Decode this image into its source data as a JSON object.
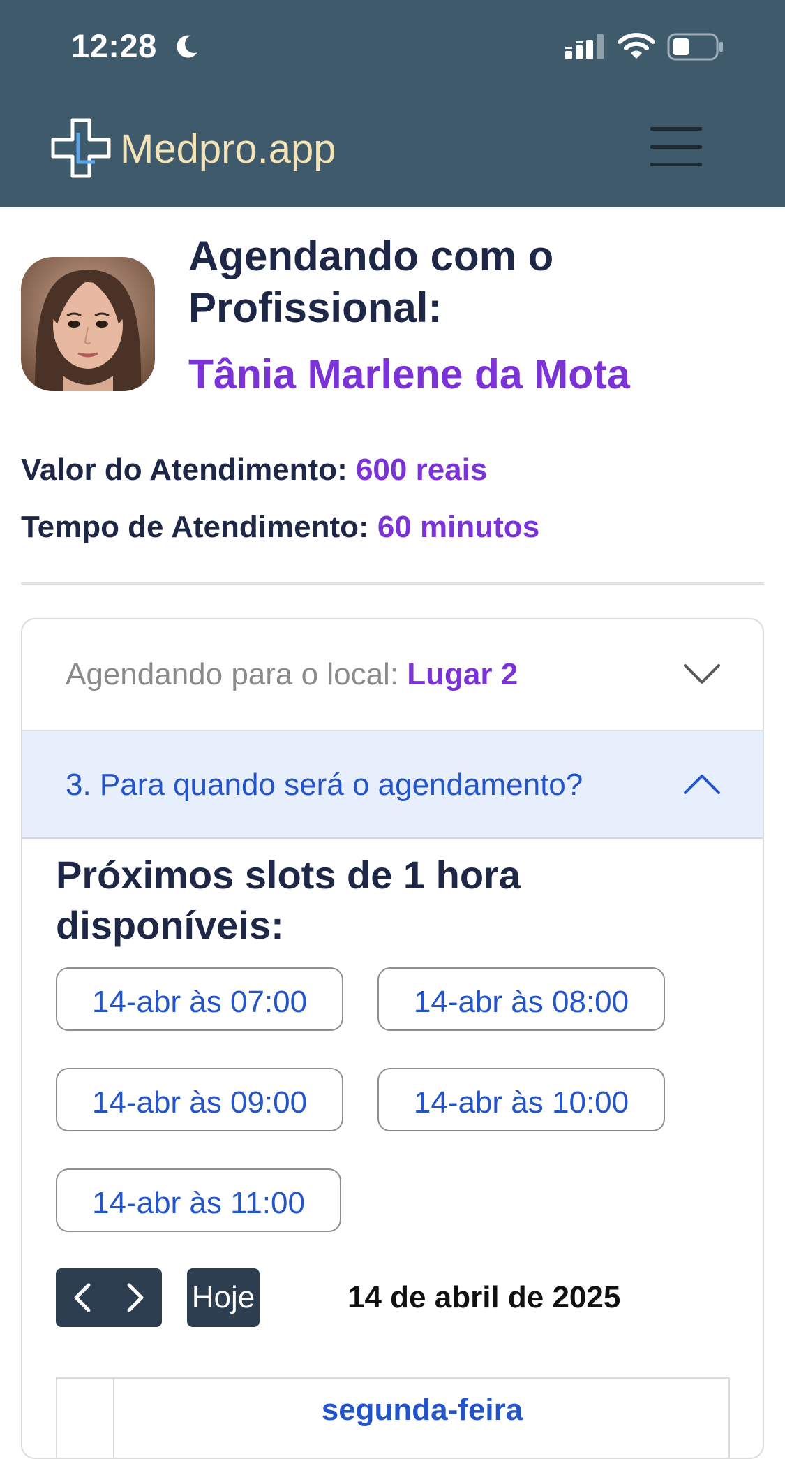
{
  "status_bar": {
    "time": "12:28"
  },
  "brand": {
    "name": "Medpro.app"
  },
  "profile": {
    "heading": "Agendando com o Profissional:",
    "name": "Tânia Marlene da Mota"
  },
  "details": {
    "price_label": "Valor do Atendimento:",
    "price_value": "600 reais",
    "duration_label": "Tempo de Atendimento:",
    "duration_value": "60 minutos"
  },
  "accordion": {
    "location_label": "Agendando para o local:",
    "location_value": "Lugar 2",
    "when_label": "3. Para quando será o agendamento?"
  },
  "slots": {
    "title": "Próximos slots de 1 hora disponíveis:",
    "items": [
      "14-abr às 07:00",
      "14-abr às 08:00",
      "14-abr às 09:00",
      "14-abr às 10:00",
      "14-abr às 11:00"
    ]
  },
  "calendar": {
    "today_label": "Hoje",
    "current_date": "14 de abril de 2025",
    "day_header": "segunda-feira"
  },
  "colors": {
    "topbar": "#3f5a6b",
    "brand_text": "#f3e3b6",
    "accent_purple": "#7b33d8",
    "link_blue": "#2355c9",
    "heading_navy": "#1e2846",
    "button_dark": "#2c3e50"
  },
  "icons": {
    "moon": "moon-icon",
    "signal": "cellular-signal-icon",
    "wifi": "wifi-icon",
    "battery": "battery-icon",
    "logo": "medical-cross-logo",
    "menu": "hamburger-menu-icon",
    "chevron_down": "chevron-down-icon",
    "chevron_up": "chevron-up-icon",
    "prev": "chevron-left-icon",
    "next": "chevron-right-icon"
  }
}
